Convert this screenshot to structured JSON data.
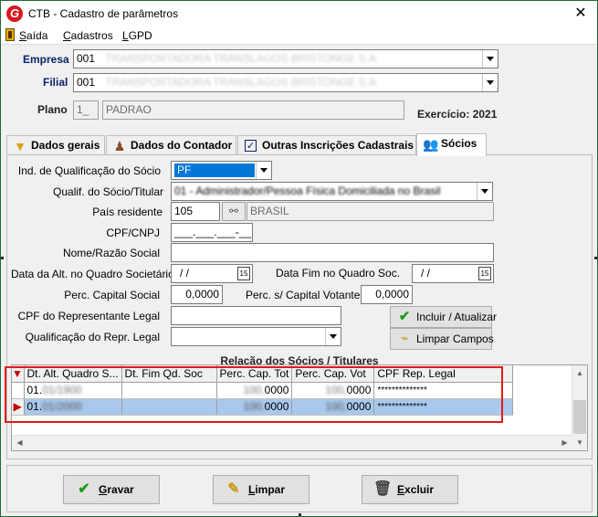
{
  "window": {
    "title": "CTB - Cadastro de parâmetros",
    "close_glyph": "✕",
    "logo_letter": "G"
  },
  "menu": {
    "items": [
      {
        "accel": "S",
        "rest": "aída"
      },
      {
        "accel": "C",
        "rest": "adastros"
      },
      {
        "accel": "L",
        "rest": "GPD"
      }
    ]
  },
  "header": {
    "empresa_label": "Empresa",
    "empresa_code": "001",
    "empresa_name": "TRANSPORTADORA TRANSLAGOS BRISTONGE S.A.",
    "filial_label": "Filial",
    "filial_code": "001",
    "filial_name": "TRANSPORTADORA TRANSLAGOS BRISTONGE S.A.",
    "plano_label": "Plano",
    "plano_code": "1_",
    "plano_name": "PADRAO",
    "exercicio_label": "Exercício: 2021"
  },
  "tabs": [
    {
      "label": "Dados gerais",
      "icon": "funnel-icon"
    },
    {
      "label": "Dados do Contador",
      "icon": "person-icon"
    },
    {
      "label": "Outras Inscrições Cadastrais",
      "icon": "checkbox-icon"
    },
    {
      "label": "Sócios",
      "icon": "people-icon",
      "active": true
    }
  ],
  "form": {
    "ind_label": "Ind. de Qualificação do Sócio",
    "ind_value": "PF",
    "qualif_label": "Qualif. do Sócio/Titular",
    "qualif_value": "01 - Administrador/Pessoa Física Domiciliada no Brasil",
    "pais_label": "País residente",
    "pais_code": "105",
    "pais_name": "BRASIL",
    "cpf_label": "CPF/CNPJ",
    "cpf_value": "___.___.___-__",
    "nome_label": "Nome/Razão Social",
    "nome_value": "",
    "dt_alt_label": "Data da Alt. no Quadro Societário",
    "dt_alt_value": "/  /",
    "dt_fim_label": "Data Fim no Quadro Soc.",
    "dt_fim_value": "/  /",
    "perc_cap_label": "Perc. Capital Social",
    "perc_cap_value": "0,0000",
    "perc_vot_label": "Perc. s/ Capital Votante",
    "perc_vot_value": "0,0000",
    "cpf_rep_label": "CPF do Representante Legal",
    "cpf_rep_value": "",
    "qual_rep_label": "Qualificação do Repr. Legal",
    "qual_rep_value": "",
    "incluir_label": "Incluir / Atualizar",
    "limpar_campos_label": "Limpar Campos",
    "calendar_glyph": "15"
  },
  "grid": {
    "title": "Relação dos Sócios / Titulares",
    "columns": [
      "Dt. Alt. Quadro S...",
      "Dt. Fim Qd. Soc",
      "Perc. Cap. Tot",
      "Perc. Cap. Vot",
      "CPF Rep. Legal"
    ],
    "rows": [
      {
        "dt_alt_prefix": "01.",
        "dt_alt_hidden": "01/1900",
        "dt_fim": "",
        "perc_tot_hidden": "100,",
        "perc_tot": "0000",
        "perc_vot_hidden": "100,",
        "perc_vot": "0000",
        "cpf_rep": "**************",
        "selected": false
      },
      {
        "dt_alt_prefix": "01.",
        "dt_alt_hidden": "01/2000",
        "dt_fim": "",
        "perc_tot_hidden": "100,",
        "perc_tot": "0000",
        "perc_vot_hidden": "100,",
        "perc_vot": "0000",
        "cpf_rep": "**************",
        "selected": true
      }
    ]
  },
  "footer": {
    "gravar_accel": "G",
    "gravar_rest": "ravar",
    "limpar_accel": "L",
    "limpar_rest": "impar",
    "excluir_accel": "E",
    "excluir_rest": "xcluir"
  },
  "colors": {
    "label_blue": "#0a246a",
    "highlight_red": "#e31a1a",
    "selection_blue": "#0078d7",
    "row_selected": "#a9c8ec"
  }
}
